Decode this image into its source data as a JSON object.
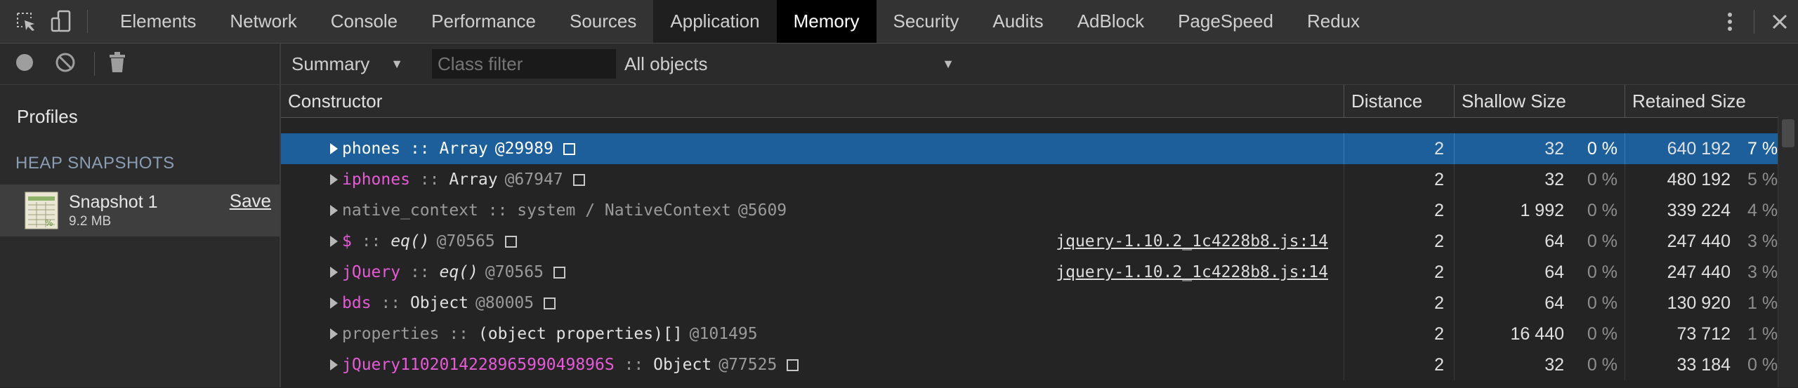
{
  "tabs": [
    "Elements",
    "Network",
    "Console",
    "Performance",
    "Sources",
    "Application",
    "Memory",
    "Security",
    "Audits",
    "AdBlock",
    "PageSpeed",
    "Redux"
  ],
  "active_tab": "Memory",
  "sidebar": {
    "profiles_title": "Profiles",
    "heap_title": "HEAP SNAPSHOTS",
    "snapshot": {
      "name": "Snapshot 1",
      "size": "9.2 MB",
      "save_label": "Save"
    }
  },
  "toolbar": {
    "view": "Summary",
    "class_filter_placeholder": "Class filter",
    "objects": "All objects"
  },
  "table": {
    "headers": {
      "constructor": "Constructor",
      "distance": "Distance",
      "shallow": "Shallow Size",
      "retained": "Retained Size"
    },
    "rows": [
      {
        "name": "phones",
        "name_style": "white",
        "type": "Array",
        "type_style": "normal",
        "id": "@29989",
        "box": true,
        "src": "",
        "distance": "2",
        "shallow": "32",
        "shallow_pct": "0 %",
        "retained": "640 192",
        "retained_pct": "7 %",
        "selected": true
      },
      {
        "name": "iphones",
        "name_style": "pink",
        "type": "Array",
        "type_style": "normal",
        "id": "@67947",
        "box": true,
        "src": "",
        "distance": "2",
        "shallow": "32",
        "shallow_pct": "0 %",
        "retained": "480 192",
        "retained_pct": "5 %",
        "selected": false
      },
      {
        "name": "native_context",
        "name_style": "grey",
        "type": "system / NativeContext",
        "type_style": "grey",
        "id": "@5609",
        "box": false,
        "src": "",
        "distance": "2",
        "shallow": "1 992",
        "shallow_pct": "0 %",
        "retained": "339 224",
        "retained_pct": "4 %",
        "selected": false
      },
      {
        "name": "$",
        "name_style": "pink",
        "type": "eq()",
        "type_style": "italic",
        "id": "@70565",
        "box": true,
        "src": "jquery-1.10.2_1c4228b8.js:14",
        "distance": "2",
        "shallow": "64",
        "shallow_pct": "0 %",
        "retained": "247 440",
        "retained_pct": "3 %",
        "selected": false
      },
      {
        "name": "jQuery",
        "name_style": "pink",
        "type": "eq()",
        "type_style": "italic",
        "id": "@70565",
        "box": true,
        "src": "jquery-1.10.2_1c4228b8.js:14",
        "distance": "2",
        "shallow": "64",
        "shallow_pct": "0 %",
        "retained": "247 440",
        "retained_pct": "3 %",
        "selected": false
      },
      {
        "name": "bds",
        "name_style": "pink",
        "type": "Object",
        "type_style": "normal",
        "id": "@80005",
        "box": true,
        "src": "",
        "distance": "2",
        "shallow": "64",
        "shallow_pct": "0 %",
        "retained": "130 920",
        "retained_pct": "1 %",
        "selected": false
      },
      {
        "name": "properties",
        "name_style": "grey",
        "type": "(object properties)[]",
        "type_style": "normal",
        "id": "@101495",
        "box": false,
        "src": "",
        "distance": "2",
        "shallow": "16 440",
        "shallow_pct": "0 %",
        "retained": "73 712",
        "retained_pct": "1 %",
        "selected": false
      },
      {
        "name": "jQuery110201422896599049896S",
        "name_style": "pink",
        "type": "Object",
        "type_style": "normal",
        "id": "@77525",
        "box": true,
        "src": "",
        "distance": "2",
        "shallow": "32",
        "shallow_pct": "0 %",
        "retained": "33 184",
        "retained_pct": "0 %",
        "selected": false
      }
    ]
  },
  "icons": [
    "inspect-icon",
    "device-toggle-icon",
    "record-icon",
    "clear-icon",
    "trash-icon",
    "kebab-menu-icon",
    "close-icon",
    "snapshot-icon"
  ],
  "colors": {
    "selected_row": "#1d5f9a",
    "pink": "#e65ad8",
    "active_tab": "#000000"
  }
}
